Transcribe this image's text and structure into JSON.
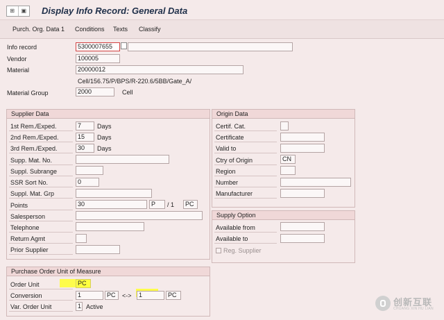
{
  "title": "Display Info Record: General Data",
  "toolbar_icon_glyphs": [
    "⊞",
    "▣"
  ],
  "menu": [
    "Purch. Org. Data 1",
    "Conditions",
    "Texts",
    "Classify"
  ],
  "header": {
    "info_record_label": "Info record",
    "info_record_value": "5300007655",
    "vendor_label": "Vendor",
    "vendor_value": "100005",
    "material_label": "Material",
    "material_value": "20000012",
    "material_desc": "Cell/156.75/P/BPS/R-220.6/5BB/Gate_A/",
    "material_group_label": "Material Group",
    "material_group_value": "2000",
    "material_group_desc": "Cell"
  },
  "supplier": {
    "heading": "Supplier Data",
    "rem1_label": "1st Rem./Exped.",
    "rem1_value": "7",
    "rem1_unit": "Days",
    "rem2_label": "2nd Rem./Exped.",
    "rem2_value": "15",
    "rem2_unit": "Days",
    "rem3_label": "3rd Rem./Exped.",
    "rem3_value": "30",
    "rem3_unit": "Days",
    "supp_mat_label": "Supp. Mat. No.",
    "subrange_label": "Suppl. Subrange",
    "ssr_label": "SSR Sort No.",
    "ssr_value": "0",
    "mat_grp_label": "Suppl. Mat. Grp",
    "points_label": "Points",
    "points_value": "30",
    "points_unit": "P",
    "points_sep": "/ 1",
    "points_per_unit": "PC",
    "salesperson_label": "Salesperson",
    "telephone_label": "Telephone",
    "return_label": "Return Agmt",
    "prior_label": "Prior Supplier"
  },
  "origin": {
    "heading": "Origin Data",
    "certif_cat_label": "Certif. Cat.",
    "certificate_label": "Certificate",
    "valid_to_label": "Valid to",
    "ctry_label": "Ctry of Origin",
    "ctry_value": "CN",
    "region_label": "Region",
    "number_label": "Number",
    "manufacturer_label": "Manufacturer"
  },
  "supply_option": {
    "heading": "Supply Option",
    "available_from_label": "Available from",
    "available_to_label": "Available to",
    "reg_supplier_label": "Reg. Supplier"
  },
  "po_unit": {
    "heading": "Purchase Order Unit of Measure",
    "order_unit_label": "Order Unit",
    "order_unit_value": "PC",
    "conversion_label": "Conversion",
    "conv_left_value": "1",
    "conv_left_unit": "PC",
    "conv_arrow": "<->",
    "conv_right_value": "1",
    "conv_right_unit": "PC",
    "var_label": "Var. Order Unit",
    "var_value": "1",
    "var_desc": "Active"
  },
  "watermark": {
    "text": "创新互联",
    "sub": "CHUANG XIN HU LIAN"
  },
  "colors": {
    "highlight": "#ffff30",
    "title_text": "#20304a",
    "box_header": "#f0d8d8"
  }
}
